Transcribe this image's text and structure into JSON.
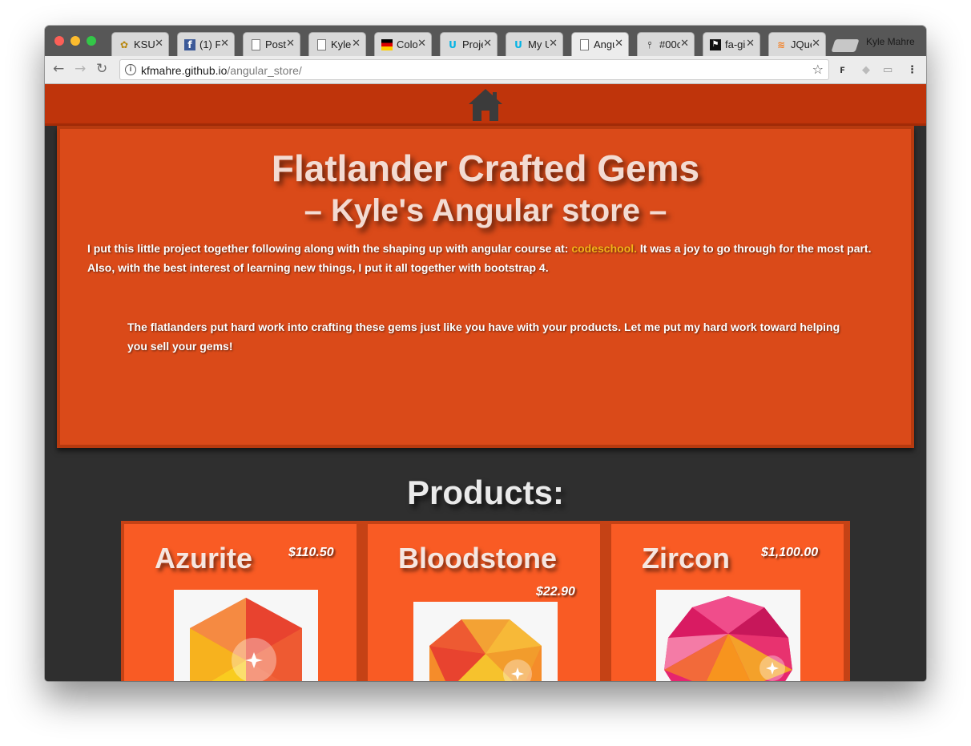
{
  "browser": {
    "tabs": [
      {
        "label": "KSU",
        "icon": "ksu-favicon"
      },
      {
        "label": "(1) F",
        "icon": "facebook-favicon"
      },
      {
        "label": "Post",
        "icon": "page-icon"
      },
      {
        "label": "Kyle",
        "icon": "page-icon"
      },
      {
        "label": "Colo",
        "icon": "colors-favicon"
      },
      {
        "label": "Proje",
        "icon": "udacity-favicon"
      },
      {
        "label": "My U",
        "icon": "udacity-favicon"
      },
      {
        "label": "Angu",
        "icon": "page-icon"
      },
      {
        "label": "#00c",
        "icon": "pin-favicon"
      },
      {
        "label": "fa-gi",
        "icon": "flag-favicon"
      },
      {
        "label": "JQue",
        "icon": "stackoverflow-favicon"
      }
    ],
    "profile_name": "Kyle Mahre",
    "url_host": "kfmahre.github.io",
    "url_path": "/angular_store/"
  },
  "page": {
    "nav_icon": "home-icon",
    "title": "Flatlander Crafted Gems",
    "subtitle": "– Kyle's Angular store –",
    "intro_before_link": "I put this little project together following along with the shaping up with angular course at: ",
    "intro_link": "codeschool.",
    "intro_after_link": " It was a joy to go through for the most part. Also, with the best interest of learning new things, I put it all together with bootstrap 4.",
    "blurb": "The flatlanders put hard work into crafting these gems just like you have with your products. Let me put my hard work toward helping you sell your gems!",
    "products_heading": "Products:",
    "products": [
      {
        "name": "Azurite",
        "price": "$110.50",
        "image": "azurite-gem-image"
      },
      {
        "name": "Bloodstone",
        "price": "$22.90",
        "image": "bloodstone-gem-image"
      },
      {
        "name": "Zircon",
        "price": "$1,100.00",
        "image": "zircon-gem-image"
      }
    ]
  },
  "colors": {
    "navbar": "#bf340b",
    "hero": "#da4a19",
    "card": "#f95b24",
    "link": "#f5b318",
    "page_bg": "#2f2f2f"
  }
}
